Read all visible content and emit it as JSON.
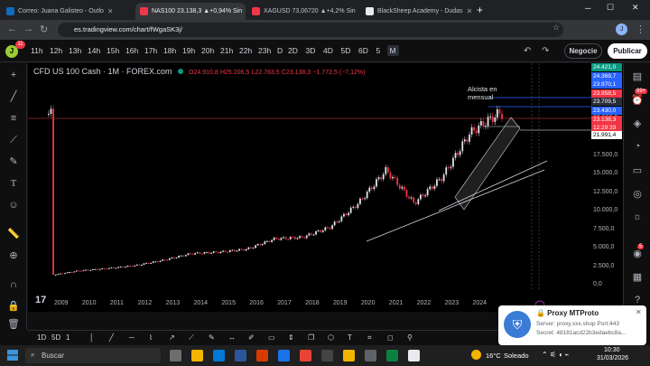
{
  "tabs": [
    {
      "title": "Correo: Juana Galisteo - Outlo",
      "color": "#0f6cbd",
      "active": false
    },
    {
      "title": "NAS100 23.138,3 ▲+0,94% Sin",
      "color": "#f23645",
      "active": true
    },
    {
      "title": "XAGUSD 73,06720 ▲+4,2% Sin",
      "color": "#f23645",
      "active": false
    },
    {
      "title": "BlackSheep Academy - Dudas",
      "color": "#e8eaed",
      "active": false
    }
  ],
  "browser": {
    "url": "es.tradingview.com/chart/fWgaSK3j/",
    "new_tab": "+",
    "menu": "⋮"
  },
  "toolbar": {
    "avatar": "J",
    "avatar_badge": "11",
    "timeframes": [
      "11h",
      "12h",
      "13h",
      "14h",
      "15h",
      "16h",
      "17h",
      "18h",
      "19h",
      "20h",
      "21h",
      "22h",
      "23h",
      "D",
      "2D",
      "3D",
      "4D",
      "5D",
      "6D",
      "5",
      "M"
    ],
    "selected": "M",
    "sell_label": "Negocie",
    "publish_label": "Publicar"
  },
  "legend": {
    "title": "CFD US 100 Cash · 1M · FOREX.com",
    "o": "O24.910,8",
    "h": "H25.206,5",
    "l": "L22.783,5",
    "c": "C23.138,3",
    "chg": "−1.772,5 (−7,12%)"
  },
  "annotation": {
    "text": "Alcista en mensual"
  },
  "price_axis": [
    "25.000,0",
    "22.500,0",
    "20.000,0",
    "17.500,0",
    "15.000,0",
    "12.500,0",
    "10.000,0",
    "7.500,0",
    "5.000,0",
    "2.500,0",
    "0,0"
  ],
  "price_labels": [
    {
      "text": "24.421,0",
      "color": "#089981"
    },
    {
      "text": "24.369,7",
      "color": "#2962ff"
    },
    {
      "text": "23.970,1",
      "color": "#2962ff"
    },
    {
      "text": "23.958,5",
      "color": "#f23645"
    },
    {
      "text": "23.709,5",
      "color": "#2a2e39"
    },
    {
      "text": "23.430,0",
      "color": "#2962ff"
    },
    {
      "text": "23.138,3",
      "color": "#f23645"
    },
    {
      "text": "12:29:33",
      "color": "#f23645"
    },
    {
      "text": "21.991,4",
      "color": "#ffffff"
    }
  ],
  "time_axis": [
    "2009",
    "2010",
    "2011",
    "2012",
    "2013",
    "2014",
    "2015",
    "2016",
    "2017",
    "2018",
    "2019",
    "2020",
    "2021",
    "2022",
    "2023",
    "2024"
  ],
  "bottom": {
    "ranges": [
      "1D",
      "5D",
      "1"
    ]
  },
  "right_badges": {
    "alerts": "99+",
    "notif": "5"
  },
  "proxy": {
    "title": "🔒 Proxy MTProto",
    "line1": "Server: proxy.xxx.shop Port:443",
    "line2": "Secret: 48181acd22b3edaebc8a...",
    "close": "✕"
  },
  "taskbar": {
    "search": "Buscar",
    "weather": "16°C",
    "weather_text": "Soleado",
    "time": "10:30",
    "date": "31/03/2026"
  },
  "chart_data": {
    "type": "candlestick",
    "title": "CFD US 100 Cash · 1M · FOREX.com",
    "x": [
      2009,
      2010,
      2011,
      2012,
      2013,
      2014,
      2015,
      2016,
      2017,
      2018,
      2019,
      2020,
      2021,
      2022,
      2023,
      2024,
      2025
    ],
    "y_approx": [
      1300,
      1900,
      2200,
      2600,
      3300,
      4200,
      4400,
      4800,
      6200,
      6400,
      7800,
      11000,
      15500,
      11000,
      14500,
      20500,
      23100
    ],
    "ylim": [
      0,
      27500
    ],
    "last": 23138.3
  }
}
